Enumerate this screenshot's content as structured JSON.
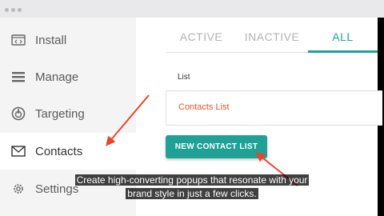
{
  "sidebar": {
    "items": [
      {
        "label": "Install",
        "icon": "code-window-icon"
      },
      {
        "label": "Manage",
        "icon": "list-icon"
      },
      {
        "label": "Targeting",
        "icon": "power-target-icon"
      },
      {
        "label": "Contacts",
        "icon": "envelope-icon"
      },
      {
        "label": "Settings",
        "icon": "gear-icon"
      }
    ]
  },
  "tabs": [
    {
      "label": "ACTIVE"
    },
    {
      "label": "INACTIVE"
    },
    {
      "label": "ALL"
    }
  ],
  "main": {
    "list_label": "List",
    "list_item": "Contacts List",
    "new_button": "NEW CONTACT LIST"
  },
  "caption": {
    "line1": "Create high-converting popups that resonate with your",
    "line2": "brand style in just a few clicks."
  },
  "colors": {
    "accent": "#1fa196",
    "link": "#e0562a",
    "annotation_arrow": "#e8452c"
  }
}
